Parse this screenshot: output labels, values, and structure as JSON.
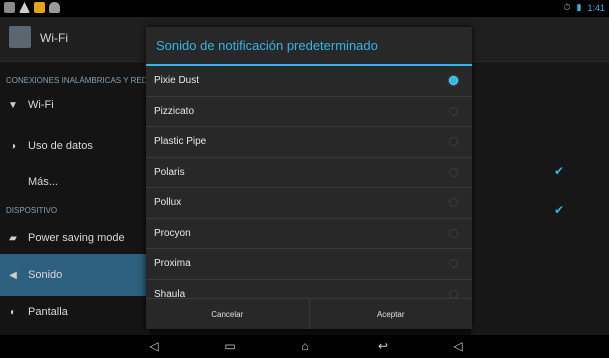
{
  "status_bar": {
    "time": "1:41",
    "accent": "#33b5e5"
  },
  "action_bar": {
    "title": "Wi-Fi"
  },
  "sidebar": {
    "section1": "CONEXIONES INALÁMBRICAS Y RED",
    "section2": "DISPOSITIVO",
    "items": [
      {
        "label": "Wi-Fi",
        "icon": "wifi-icon"
      },
      {
        "label": "Uso de datos",
        "icon": "data-usage-icon"
      },
      {
        "label": "Más...",
        "icon": ""
      },
      {
        "label": "Power saving mode",
        "icon": "battery-icon"
      },
      {
        "label": "Sonido",
        "icon": "sound-icon",
        "selected": true
      },
      {
        "label": "Pantalla",
        "icon": "display-icon"
      }
    ]
  },
  "dialog": {
    "title": "Sonido de notificación predeterminado",
    "options": [
      {
        "label": "Pixie Dust",
        "selected": true
      },
      {
        "label": "Pizzicato",
        "selected": false
      },
      {
        "label": "Plastic Pipe",
        "selected": false
      },
      {
        "label": "Polaris",
        "selected": false
      },
      {
        "label": "Pollux",
        "selected": false
      },
      {
        "label": "Procyon",
        "selected": false
      },
      {
        "label": "Proxima",
        "selected": false
      },
      {
        "label": "Shaula",
        "selected": false
      }
    ],
    "cancel_label": "Cancelar",
    "accept_label": "Aceptar"
  }
}
